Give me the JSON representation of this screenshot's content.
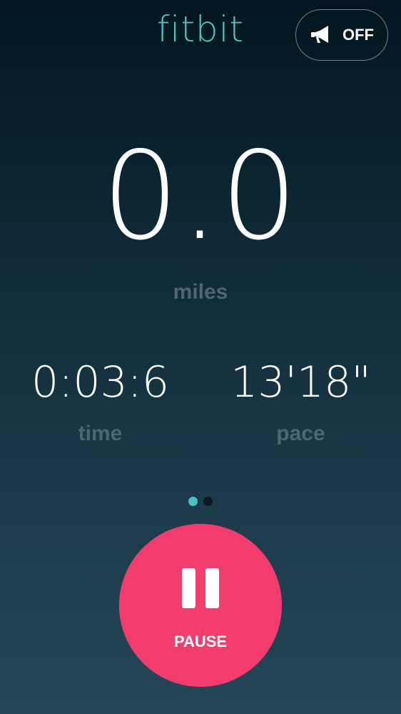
{
  "header": {
    "logo_text": "fitbit",
    "voice_cue": {
      "icon": "megaphone-icon",
      "label": "OFF"
    }
  },
  "main": {
    "distance_value": "0.0",
    "distance_unit": "miles",
    "stats": [
      {
        "value": "0:03:6",
        "label": "time"
      },
      {
        "value": "13'18\"",
        "label": "pace"
      }
    ],
    "pager": {
      "pages": 2,
      "active_index": 0
    }
  },
  "controls": {
    "pause_label": "PAUSE",
    "pause_icon": "pause-icon"
  },
  "colors": {
    "brand_teal": "#4cc2c4",
    "pause_pink": "#f23d6d",
    "muted_label": "#4e6672"
  }
}
